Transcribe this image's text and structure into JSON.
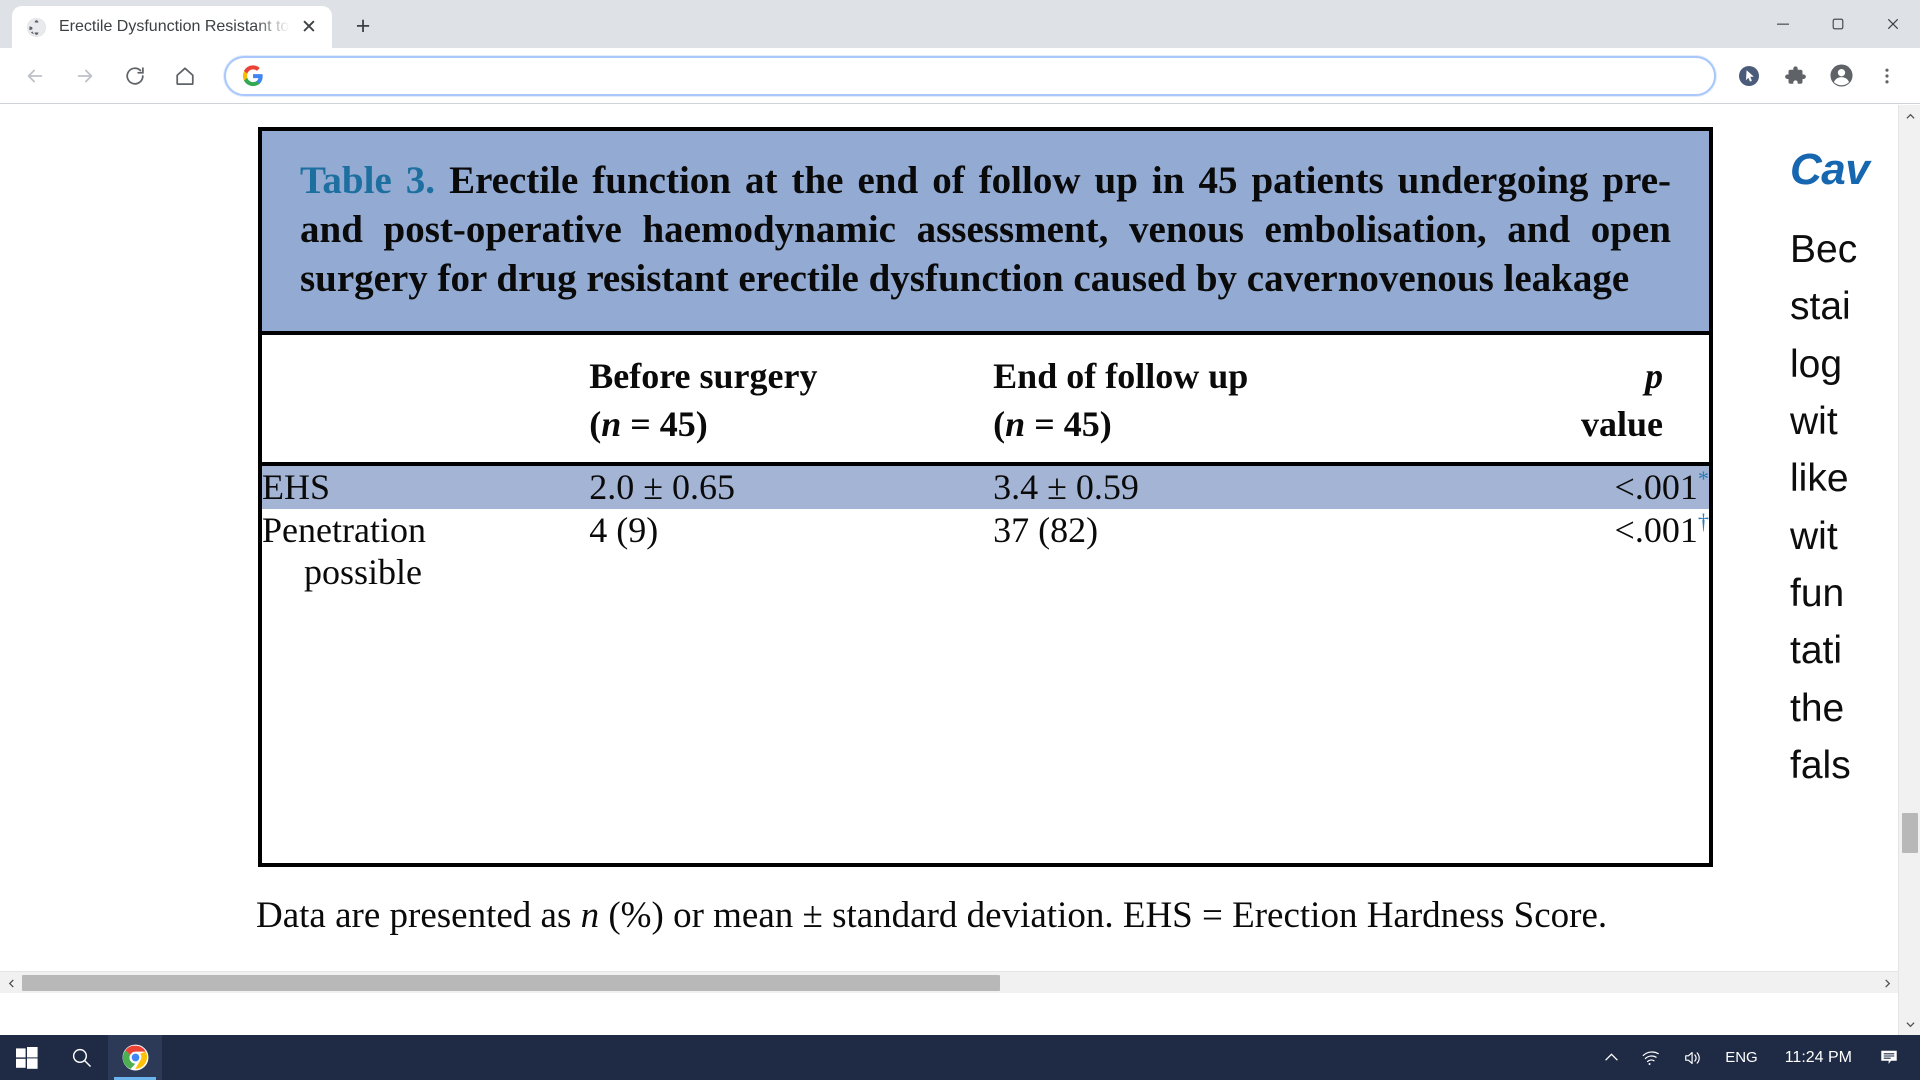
{
  "browser": {
    "tab": {
      "title": "Erectile Dysfunction Resistant to",
      "favicon_name": "globe-favicon",
      "close_label": "✕"
    },
    "new_tab_label": "+",
    "window_controls": {
      "minimize": "─",
      "maximize": "❐",
      "close": "✕"
    },
    "nav": {
      "back": "←",
      "forward": "→",
      "reload": "↻",
      "home": "⌂"
    },
    "omnibox": {
      "value": "",
      "placeholder": "",
      "engine_icon": "google-g-icon"
    },
    "toolbar_icons": [
      {
        "name": "cursor-badge-icon",
        "glyph": "➤"
      },
      {
        "name": "extensions-puzzle-icon",
        "glyph": "❖"
      },
      {
        "name": "profile-avatar-icon",
        "glyph": "●"
      },
      {
        "name": "chrome-menu-icon",
        "glyph": "⋮"
      }
    ]
  },
  "page": {
    "table": {
      "caption_number": "Table 3.",
      "caption_text": "Erectile function at the end of follow up in 45 patients undergoing pre- and post-operative haemodynamic assessment, venous embolisation, and open surgery for drug resistant erectile dysfunction caused by cavernovenous leakage",
      "columns": [
        {
          "name": "row-label-column",
          "line1": "",
          "line2": ""
        },
        {
          "name": "before-surgery-column",
          "line1": "Before surgery",
          "line2_pre": "(",
          "line2_n": "n",
          "line2_post": " =  45)"
        },
        {
          "name": "end-of-follow-up-column",
          "line1": "End of follow up",
          "line2_pre": "(",
          "line2_n": "n",
          "line2_post": " =  45)"
        },
        {
          "name": "p-value-column",
          "line1": "p",
          "line2": "value"
        }
      ],
      "rows": [
        {
          "name": "ehs-row",
          "label": "EHS",
          "label_hang": "",
          "before_surgery": "2.0 ± 0.65",
          "end_of_follow_up": "3.4 ± 0.59",
          "p_value": "<.001",
          "p_marker": "*",
          "highlighted": true
        },
        {
          "name": "penetration-possible-row",
          "label": "Penetration",
          "label_hang": "possible",
          "before_surgery": "4 (9)",
          "end_of_follow_up": "37 (82)",
          "p_value": "<.001",
          "p_marker": "†",
          "highlighted": false
        }
      ],
      "footnote_part1": "Data are presented as ",
      "footnote_n": "n",
      "footnote_part2": " (%) or mean ± standard deviation. EHS = Erection Hardness Score."
    },
    "right_column": {
      "heading": "Cav",
      "lines": [
        "Bec",
        "stai",
        "log",
        "wit",
        "like",
        "wit",
        "fun",
        "tati",
        "the",
        "fals"
      ]
    },
    "scrollbars": {
      "vertical_up": "▲",
      "vertical_down": "▼",
      "horizontal_left": "◀",
      "horizontal_right": "▶"
    },
    "colors": {
      "caption_band": "#93abd3",
      "row_highlight": "#a3b4d4",
      "table_number": "#1d6fa0",
      "footnote_marker": "#2e7bb5",
      "right_heading": "#1666b0"
    }
  },
  "taskbar": {
    "start_label": "start-button",
    "search_label": "search-button",
    "chrome_label": "chrome-taskbar-button",
    "tray": {
      "show_hidden": "∧",
      "network": "network-wifi-icon",
      "volume": "volume-icon",
      "language": "ENG",
      "clock": "11:24 PM",
      "notifications": "notification-icon"
    }
  }
}
